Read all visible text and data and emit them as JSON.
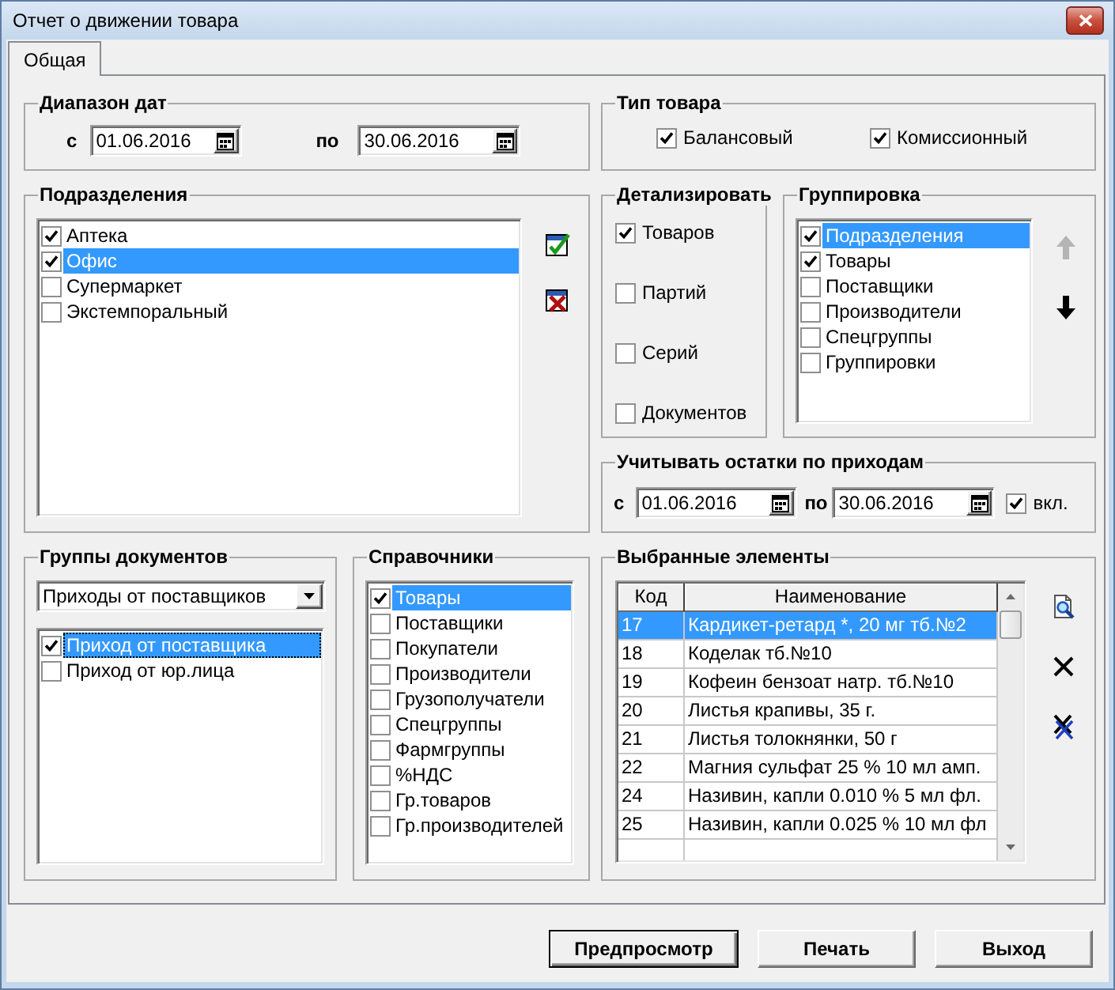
{
  "window": {
    "title": "Отчет о движении товара"
  },
  "tabs": [
    {
      "label": "Общая",
      "selected": true
    }
  ],
  "date_range": {
    "title": "Диапазон дат",
    "from_label": "с",
    "from": "01.06.2016",
    "to_label": "по",
    "to": "30.06.2016"
  },
  "product_type": {
    "title": "Тип товара",
    "options": [
      {
        "label": "Балансовый",
        "checked": true
      },
      {
        "label": "Комиссионный",
        "checked": true
      }
    ]
  },
  "departments": {
    "title": "Подразделения",
    "items": [
      {
        "label": "Аптека",
        "checked": true,
        "selected": false
      },
      {
        "label": "Офис",
        "checked": true,
        "selected": true
      },
      {
        "label": "Супермаркет",
        "checked": false,
        "selected": false
      },
      {
        "label": "Экстемпоральный",
        "checked": false,
        "selected": false
      }
    ]
  },
  "detail": {
    "title": "Детализировать",
    "options": [
      {
        "label": "Товаров",
        "checked": true
      },
      {
        "label": "Партий",
        "checked": false
      },
      {
        "label": "Серий",
        "checked": false
      },
      {
        "label": "Документов",
        "checked": false
      }
    ]
  },
  "grouping": {
    "title": "Группировка",
    "items": [
      {
        "label": "Подразделения",
        "checked": true,
        "selected": true
      },
      {
        "label": "Товары",
        "checked": true,
        "selected": false
      },
      {
        "label": "Поставщики",
        "checked": false,
        "selected": false
      },
      {
        "label": "Производители",
        "checked": false,
        "selected": false
      },
      {
        "label": "Спецгруппы",
        "checked": false,
        "selected": false
      },
      {
        "label": "Группировки",
        "checked": false,
        "selected": false
      }
    ],
    "order_buttons": [
      {
        "kind": "up",
        "disabled": true
      },
      {
        "kind": "down",
        "disabled": false
      }
    ]
  },
  "remainders": {
    "title": "Учитывать остатки по приходам",
    "from_label": "с",
    "from": "01.06.2016",
    "to_label": "по",
    "to": "30.06.2016",
    "enable": {
      "label": "вкл.",
      "checked": true
    }
  },
  "document_groups": {
    "title": "Группы документов",
    "dropdown": {
      "value": "Приходы от поставщиков"
    },
    "items": [
      {
        "label": "Приход от поставщика",
        "checked": true,
        "selected": true,
        "focused": true
      },
      {
        "label": "Приход от юр.лица",
        "checked": false,
        "selected": false,
        "focused": false
      }
    ]
  },
  "references": {
    "title": "Справочники",
    "items": [
      {
        "label": "Товары",
        "checked": true,
        "selected": true
      },
      {
        "label": "Поставщики",
        "checked": false,
        "selected": false
      },
      {
        "label": "Покупатели",
        "checked": false,
        "selected": false
      },
      {
        "label": "Производители",
        "checked": false,
        "selected": false
      },
      {
        "label": "Грузополучатели",
        "checked": false,
        "selected": false
      },
      {
        "label": "Спецгруппы",
        "checked": false,
        "selected": false
      },
      {
        "label": "Фармгруппы",
        "checked": false,
        "selected": false
      },
      {
        "label": "%НДС",
        "checked": false,
        "selected": false
      },
      {
        "label": "Гр.товаров",
        "checked": false,
        "selected": false
      },
      {
        "label": "Гр.производителей",
        "checked": false,
        "selected": false
      }
    ]
  },
  "selected_elements": {
    "title": "Выбранные элементы",
    "table": {
      "columns": [
        "Код",
        "Наименование"
      ],
      "rows": [
        {
          "cells": [
            "17",
            "Кардикет-ретард *, 20 мг тб.№2"
          ],
          "selected": true
        },
        {
          "cells": [
            "18",
            "Коделак тб.№10"
          ],
          "selected": false
        },
        {
          "cells": [
            "19",
            "Кофеин бензоат натр. тб.№10"
          ],
          "selected": false
        },
        {
          "cells": [
            "20",
            "Листья крапивы, 35 г."
          ],
          "selected": false
        },
        {
          "cells": [
            "21",
            "Листья толокнянки, 50 г"
          ],
          "selected": false
        },
        {
          "cells": [
            "22",
            "Магния сульфат 25 % 10 мл амп."
          ],
          "selected": false
        },
        {
          "cells": [
            "24",
            "Називин, капли 0.010 % 5 мл фл."
          ],
          "selected": false
        },
        {
          "cells": [
            "25",
            "Називин, капли 0.025 % 10 мл фл"
          ],
          "selected": false
        }
      ]
    }
  },
  "buttons": [
    {
      "label": "Предпросмотр",
      "default": true
    },
    {
      "label": "Печать",
      "default": false
    },
    {
      "label": "Выход",
      "default": false
    }
  ]
}
